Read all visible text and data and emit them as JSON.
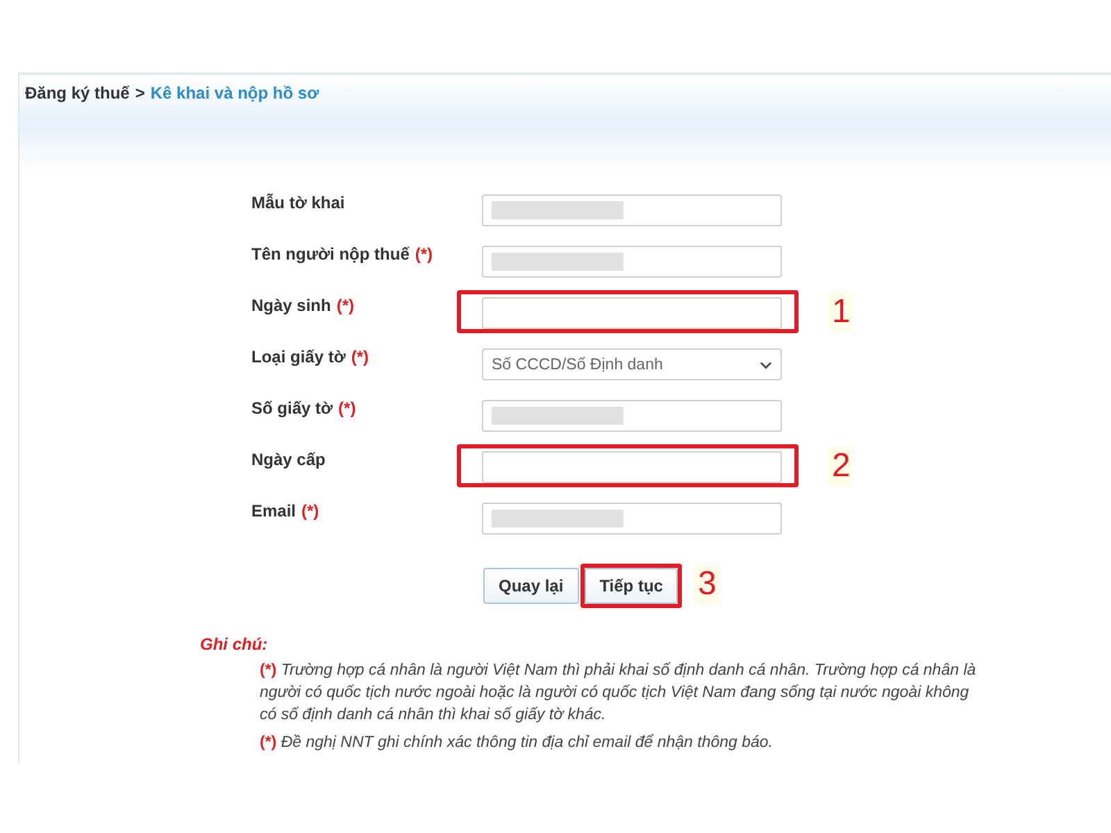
{
  "breadcrumb": {
    "parent": "Đăng ký thuế",
    "separator": ">",
    "current": "Kê khai và nộp hồ sơ"
  },
  "fields": [
    {
      "label": "Mẫu tờ khai",
      "kind": "text",
      "masked": true,
      "highlighted": false
    },
    {
      "label": "Tên người nộp thuế",
      "required_mark": "(*)",
      "kind": "text",
      "masked": true,
      "highlighted": false
    },
    {
      "label": "Ngày sinh",
      "required_mark": "(*)",
      "kind": "text",
      "masked": false,
      "highlighted": true,
      "callout": "1"
    },
    {
      "label": "Loại giấy tờ",
      "required_mark": "(*)",
      "kind": "select",
      "value": "Số CCCD/Số Định danh",
      "highlighted": false
    },
    {
      "label": "Số giấy tờ",
      "required_mark": "(*)",
      "kind": "text",
      "masked": true,
      "highlighted": false
    },
    {
      "label": "Ngày cấp",
      "kind": "text",
      "masked": false,
      "highlighted": true,
      "callout": "2"
    },
    {
      "label": "Email",
      "required_mark": "(*)",
      "kind": "text",
      "masked": true,
      "highlighted": false
    }
  ],
  "buttons": [
    {
      "label": "Quay lại",
      "highlighted": false
    },
    {
      "label": "Tiếp tục",
      "highlighted": true,
      "callout": "3"
    }
  ],
  "notes": {
    "title": "Ghi chú:",
    "items": [
      {
        "marker": "(*)",
        "text": "Trường hợp cá nhân là người Việt Nam thì phải khai số định danh cá nhân. Trường hợp cá nhân là người có quốc tịch nước ngoài hoặc là người có quốc tịch Việt Nam đang sống tại nước ngoài không có số định danh cá nhân thì khai số giấy tờ khác."
      },
      {
        "marker": "(*)",
        "text": "Đề nghị NNT ghi chính xác thông tin địa chỉ email để nhận thông báo."
      }
    ]
  }
}
